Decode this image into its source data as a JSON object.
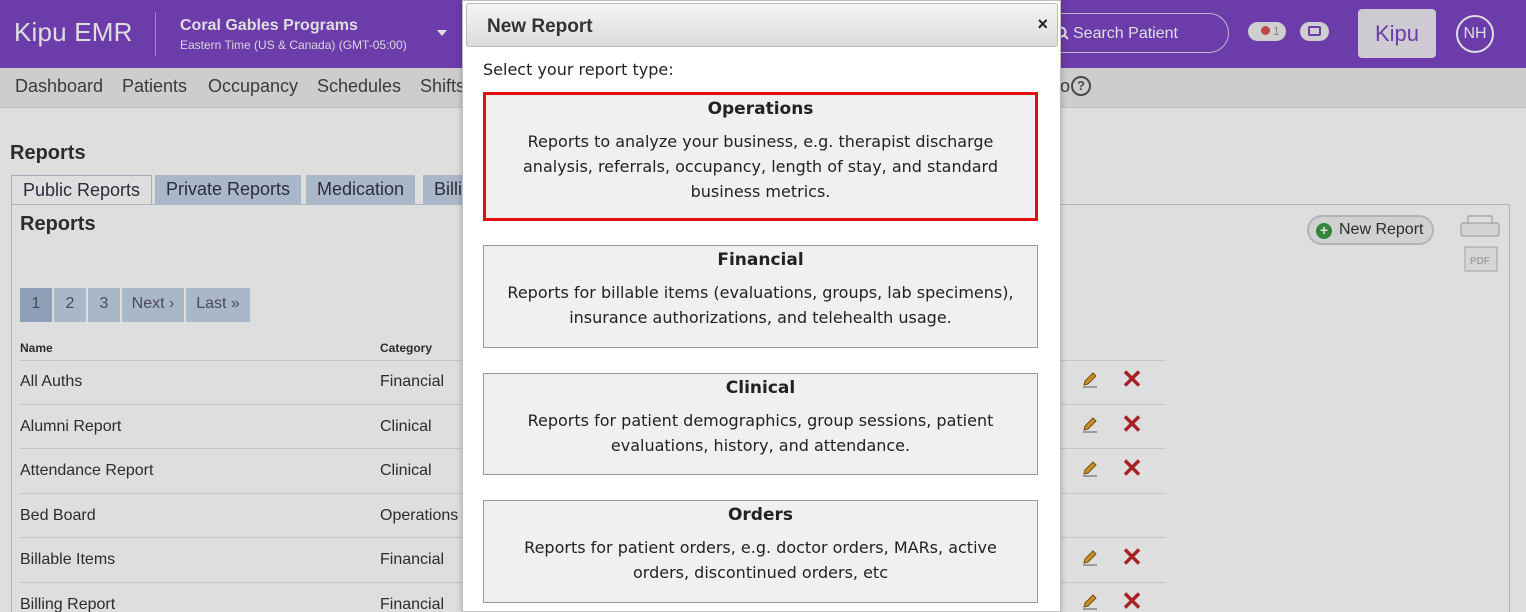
{
  "app": {
    "brand": "Kipu EMR",
    "accent": "#7b45c4"
  },
  "program": {
    "name": "Coral Gables Programs",
    "timezone": "Eastern Time (US & Canada) (GMT-05:00)"
  },
  "header": {
    "search_placeholder": "Search Patient",
    "notification_count": "1",
    "kipu_button": "Kipu",
    "avatar_initials": "NH"
  },
  "nav": {
    "items": [
      "Dashboard",
      "Patients",
      "Occupancy",
      "Schedules",
      "Shifts"
    ],
    "trailing_fragment": "o"
  },
  "page": {
    "title": "Reports",
    "tabs": [
      "Public Reports",
      "Private Reports",
      "Medication",
      "Billi"
    ],
    "panel_title": "Reports",
    "new_report_label": "New Report",
    "pagination": [
      "1",
      "2",
      "3",
      "Next ›",
      "Last »"
    ],
    "columns": {
      "name": "Name",
      "category": "Category"
    },
    "rows": [
      {
        "name": "All Auths",
        "category": "Financial",
        "editable": true
      },
      {
        "name": "Alumni Report",
        "category": "Clinical",
        "editable": true
      },
      {
        "name": "Attendance Report",
        "category": "Clinical",
        "editable": true
      },
      {
        "name": "Bed Board",
        "category": "Operations",
        "editable": false
      },
      {
        "name": "Billable Items",
        "category": "Financial",
        "editable": true
      },
      {
        "name": "Billing Report",
        "category": "Financial",
        "editable": true
      }
    ]
  },
  "modal": {
    "title": "New Report",
    "close": "×",
    "prompt": "Select your report type:",
    "options": [
      {
        "title": "Operations",
        "description": "Reports to analyze your business, e.g. therapist discharge analysis, referrals, occupancy, length of stay, and standard business metrics.",
        "selected": true
      },
      {
        "title": "Financial",
        "description": "Reports for billable items (evaluations, groups, lab specimens), insurance authorizations, and telehealth usage.",
        "selected": false
      },
      {
        "title": "Clinical",
        "description": "Reports for patient demographics, group sessions, patient evaluations, history, and attendance.",
        "selected": false
      },
      {
        "title": "Orders",
        "description": "Reports for patient orders, e.g. doctor orders, MARs, active orders, discontinued orders, etc",
        "selected": false
      }
    ]
  },
  "icons": {
    "edit": "pencil-icon",
    "delete": "delete-icon",
    "print": "printer-icon",
    "pdf": "pdf-icon",
    "help": "help-icon"
  }
}
